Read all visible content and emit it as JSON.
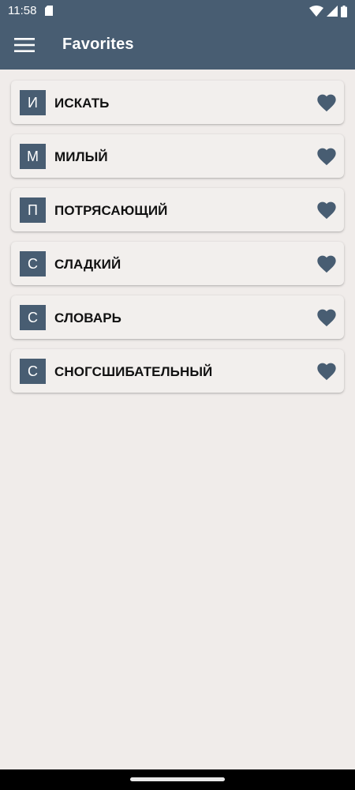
{
  "status_bar": {
    "time": "11:58",
    "icons": [
      "sd-card-icon",
      "wifi-icon",
      "signal-icon",
      "battery-icon"
    ]
  },
  "app_bar": {
    "title": "Favorites",
    "menu_icon": "hamburger-menu-icon"
  },
  "colors": {
    "primary": "#485d72",
    "background": "#f0ecea",
    "card": "#f2efed",
    "text": "#111111"
  },
  "favorites": [
    {
      "letter": "И",
      "word": "ИСКАТЬ",
      "icon": "heart-icon"
    },
    {
      "letter": "М",
      "word": "МИЛЫЙ",
      "icon": "heart-icon"
    },
    {
      "letter": "П",
      "word": "ПОТРЯСАЮЩИЙ",
      "icon": "heart-icon"
    },
    {
      "letter": "С",
      "word": "СЛАДКИЙ",
      "icon": "heart-icon"
    },
    {
      "letter": "С",
      "word": "СЛОВАРЬ",
      "icon": "heart-icon"
    },
    {
      "letter": "С",
      "word": "СНОГСШИБАТЕЛЬНЫЙ",
      "icon": "heart-icon"
    }
  ]
}
